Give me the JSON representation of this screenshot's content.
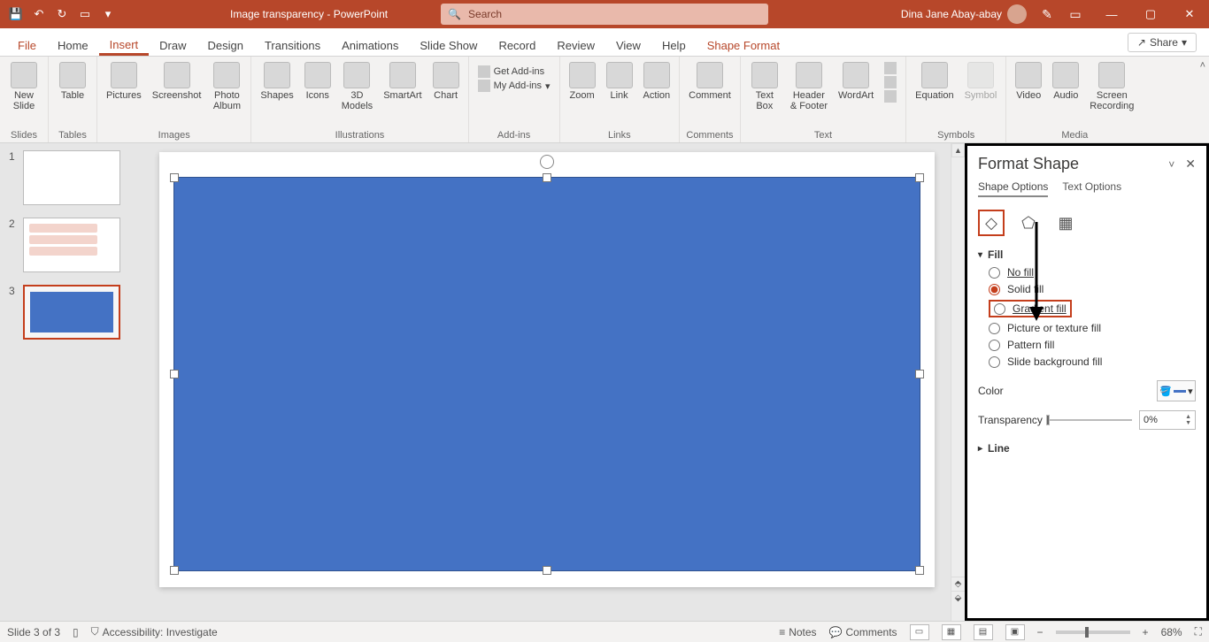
{
  "titlebar": {
    "title": "Image transparency  -  PowerPoint",
    "search_placeholder": "Search",
    "user_name": "Dina Jane Abay-abay"
  },
  "tabs": {
    "file": "File",
    "home": "Home",
    "insert": "Insert",
    "draw": "Draw",
    "design": "Design",
    "transitions": "Transitions",
    "animations": "Animations",
    "slideshow": "Slide Show",
    "record": "Record",
    "review": "Review",
    "view": "View",
    "help": "Help",
    "shape_format": "Shape Format",
    "share": "Share"
  },
  "ribbon": {
    "groups": {
      "slides": "Slides",
      "tables": "Tables",
      "images": "Images",
      "illustrations": "Illustrations",
      "addins": "Add-ins",
      "links": "Links",
      "comments": "Comments",
      "text": "Text",
      "symbols": "Symbols",
      "media": "Media"
    },
    "items": {
      "new_slide": "New\nSlide",
      "table": "Table",
      "pictures": "Pictures",
      "screenshot": "Screenshot",
      "photo_album": "Photo\nAlbum",
      "shapes": "Shapes",
      "icons": "Icons",
      "models3d": "3D\nModels",
      "smartart": "SmartArt",
      "chart": "Chart",
      "get_addins": "Get Add-ins",
      "my_addins": "My Add-ins",
      "zoom": "Zoom",
      "link": "Link",
      "action": "Action",
      "comment": "Comment",
      "text_box": "Text\nBox",
      "header_footer": "Header\n& Footer",
      "wordart": "WordArt",
      "equation": "Equation",
      "symbol": "Symbol",
      "video": "Video",
      "audio": "Audio",
      "screen_rec": "Screen\nRecording"
    }
  },
  "slide_thumbs": [
    "1",
    "2",
    "3"
  ],
  "format_pane": {
    "title": "Format Shape",
    "shape_options": "Shape Options",
    "text_options": "Text Options",
    "fill_section": "Fill",
    "line_section": "Line",
    "no_fill": "No fill",
    "solid_fill": "Solid fill",
    "gradient_fill": "Gradient fill",
    "picture_fill": "Picture or texture fill",
    "pattern_fill": "Pattern fill",
    "slide_bg_fill": "Slide background fill",
    "color_label": "Color",
    "transparency_label": "Transparency",
    "transparency_value": "0%"
  },
  "status": {
    "slide_info": "Slide 3 of 3",
    "accessibility": "Accessibility: Investigate",
    "notes": "Notes",
    "comments": "Comments",
    "zoom": "68%"
  }
}
